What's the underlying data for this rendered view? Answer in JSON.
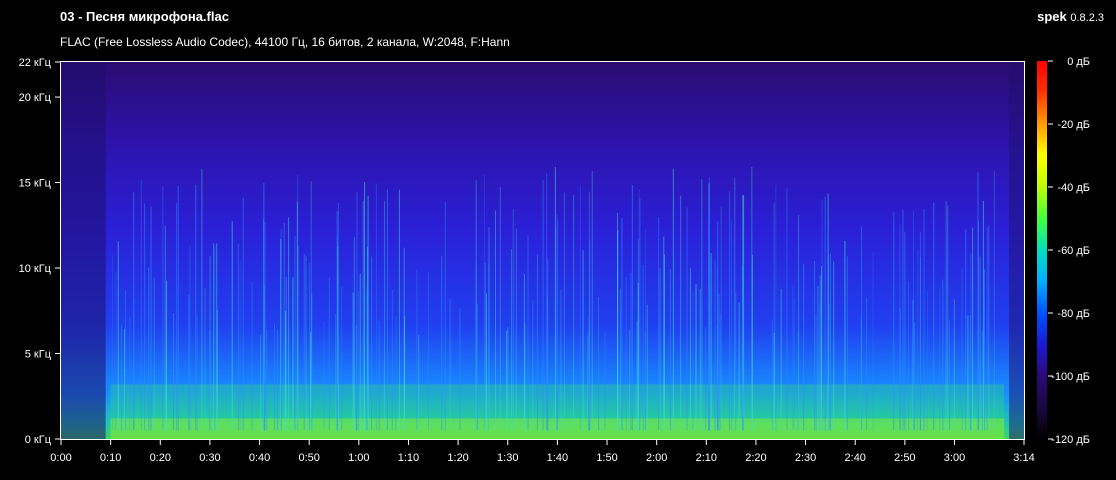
{
  "window": {
    "title": "03 - Песня микрофона.flac",
    "subtitle": "FLAC (Free Lossless Audio Codec), 44100 Гц, 16 битов, 2 канала, W:2048, F:Hann",
    "app_name": "spek",
    "app_version": "0.8.2.3"
  },
  "colors": {
    "background": "#000000",
    "text": "#ffffff",
    "colormap": [
      "#000000",
      "#1a0840",
      "#2d0a7a",
      "#1a1ad6",
      "#0050ff",
      "#00b0ff",
      "#00e0c0",
      "#40ff40",
      "#c0ff00",
      "#ffff00",
      "#ffa000",
      "#ff3000",
      "#ff0000"
    ]
  },
  "chart_data": {
    "type": "heatmap",
    "title": "03 - Песня микрофона.flac",
    "subtitle": "FLAC (Free Lossless Audio Codec), 44100 Гц, 16 битов, 2 канала, W:2048, F:Hann",
    "xlabel": "",
    "ylabel": "",
    "x_range_seconds": [
      0,
      194
    ],
    "y_range_khz": [
      0,
      22.05
    ],
    "x_ticks": [
      {
        "t": 0,
        "label": "0:00"
      },
      {
        "t": 10,
        "label": "0:10"
      },
      {
        "t": 20,
        "label": "0:20"
      },
      {
        "t": 30,
        "label": "0:30"
      },
      {
        "t": 40,
        "label": "0:40"
      },
      {
        "t": 50,
        "label": "0:50"
      },
      {
        "t": 60,
        "label": "1:00"
      },
      {
        "t": 70,
        "label": "1:10"
      },
      {
        "t": 80,
        "label": "1:20"
      },
      {
        "t": 90,
        "label": "1:30"
      },
      {
        "t": 100,
        "label": "1:40"
      },
      {
        "t": 110,
        "label": "1:50"
      },
      {
        "t": 120,
        "label": "2:00"
      },
      {
        "t": 130,
        "label": "2:10"
      },
      {
        "t": 140,
        "label": "2:20"
      },
      {
        "t": 150,
        "label": "2:30"
      },
      {
        "t": 160,
        "label": "2:40"
      },
      {
        "t": 170,
        "label": "2:50"
      },
      {
        "t": 180,
        "label": "3:00"
      },
      {
        "t": 194,
        "label": "3:14"
      }
    ],
    "y_ticks": [
      {
        "khz": 0,
        "label": "0 кГц"
      },
      {
        "khz": 5,
        "label": "5 кГц"
      },
      {
        "khz": 10,
        "label": "10 кГц"
      },
      {
        "khz": 15,
        "label": "15 кГц"
      },
      {
        "khz": 20,
        "label": "20 кГц"
      },
      {
        "khz": 22.05,
        "label": "22 кГц"
      }
    ],
    "colorbar_db_range": [
      -120,
      0
    ],
    "colorbar_ticks": [
      {
        "db": 0,
        "label": "0 дБ"
      },
      {
        "db": -20,
        "label": "-20 дБ"
      },
      {
        "db": -40,
        "label": "-40 дБ"
      },
      {
        "db": -60,
        "label": "-60 дБ"
      },
      {
        "db": -80,
        "label": "-80 дБ"
      },
      {
        "db": -100,
        "label": "-100 дБ"
      },
      {
        "db": -120,
        "label": "-120 дБ"
      }
    ],
    "energy_profile_db": [
      {
        "khz": 0.2,
        "db": -40
      },
      {
        "khz": 1.0,
        "db": -55
      },
      {
        "khz": 2.0,
        "db": -65
      },
      {
        "khz": 3.5,
        "db": -75
      },
      {
        "khz": 5,
        "db": -85
      },
      {
        "khz": 8,
        "db": -90
      },
      {
        "khz": 12,
        "db": -97
      },
      {
        "khz": 15,
        "db": -103
      },
      {
        "khz": 18,
        "db": -108
      },
      {
        "khz": 22,
        "db": -112
      }
    ]
  }
}
